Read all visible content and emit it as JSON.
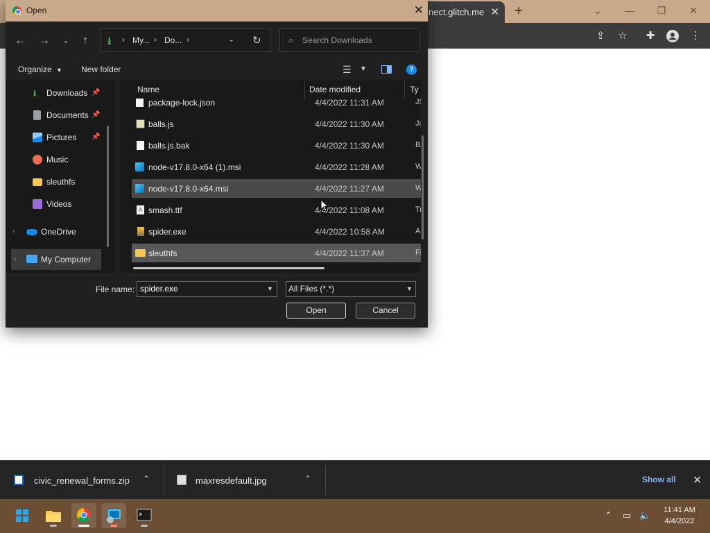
{
  "browser": {
    "tab_title": "nect.glitch.me",
    "tab_close": "✕",
    "new_tab": "+"
  },
  "dialog": {
    "title": "Open",
    "breadcrumbs": [
      "My...",
      "Do..."
    ],
    "search_placeholder": "Search Downloads",
    "organize_label": "Organize",
    "new_folder_label": "New folder",
    "help_label": "?",
    "sidebar": {
      "items": [
        {
          "label": "Downloads",
          "pinned": true,
          "icon": "download-icon",
          "color": "#4caf50"
        },
        {
          "label": "Documents",
          "pinned": true,
          "icon": "document-icon",
          "color": "#9aa0a6"
        },
        {
          "label": "Pictures",
          "pinned": true,
          "icon": "picture-icon",
          "color": "#42a5f5"
        },
        {
          "label": "Music",
          "pinned": false,
          "icon": "music-icon",
          "color": "#ef6c57"
        },
        {
          "label": "sleuthfs",
          "pinned": false,
          "icon": "folder-icon",
          "color": "#f6c84f"
        },
        {
          "label": "Videos",
          "pinned": false,
          "icon": "video-icon",
          "color": "#9c6bd8"
        },
        {
          "label": "OneDrive",
          "pinned": false,
          "icon": "cloud-icon",
          "color": "#1e88e5"
        },
        {
          "label": "My Computer",
          "pinned": false,
          "icon": "computer-icon",
          "color": "#42a5f5"
        }
      ]
    },
    "columns": {
      "name": "Name",
      "date": "Date modified",
      "type": "Ty"
    },
    "files": [
      {
        "name": "package-lock.json",
        "date": "4/4/2022 11:31 AM",
        "type": "JS",
        "icon": "blank-file-icon",
        "selected": false
      },
      {
        "name": "balls.js",
        "date": "4/4/2022 11:30 AM",
        "type": "Ja",
        "icon": "script-file-icon",
        "selected": false
      },
      {
        "name": "balls.js.bak",
        "date": "4/4/2022 11:30 AM",
        "type": "B/",
        "icon": "blank-file-icon",
        "selected": false
      },
      {
        "name": "node-v17.8.0-x64 (1).msi",
        "date": "4/4/2022 11:28 AM",
        "type": "W",
        "icon": "installer-icon",
        "selected": false
      },
      {
        "name": "node-v17.8.0-x64.msi",
        "date": "4/4/2022 11:27 AM",
        "type": "W",
        "icon": "installer-icon",
        "selected": true
      },
      {
        "name": "smash.ttf",
        "date": "4/4/2022 11:08 AM",
        "type": "Tr",
        "icon": "font-file-icon",
        "selected": false
      },
      {
        "name": "spider.exe",
        "date": "4/4/2022 10:58 AM",
        "type": "Ap",
        "icon": "exe-icon",
        "selected": false
      },
      {
        "name": "sleuthfs",
        "date": "4/4/2022 11:37 AM",
        "type": "Fi",
        "icon": "folder-icon",
        "selected": true
      }
    ],
    "file_name_label": "File name:",
    "file_name_value": "spider.exe",
    "file_type_value": "All Files (*.*)",
    "open_label": "Open",
    "cancel_label": "Cancel"
  },
  "downloads": {
    "items": [
      {
        "name": "civic_renewal_forms.zip",
        "icon": "zip-file-icon"
      },
      {
        "name": "maxresdefault.jpg",
        "icon": "image-file-icon"
      }
    ],
    "show_all": "Show all"
  },
  "taskbar": {
    "time": "11:41 AM",
    "date": "4/4/2022"
  }
}
